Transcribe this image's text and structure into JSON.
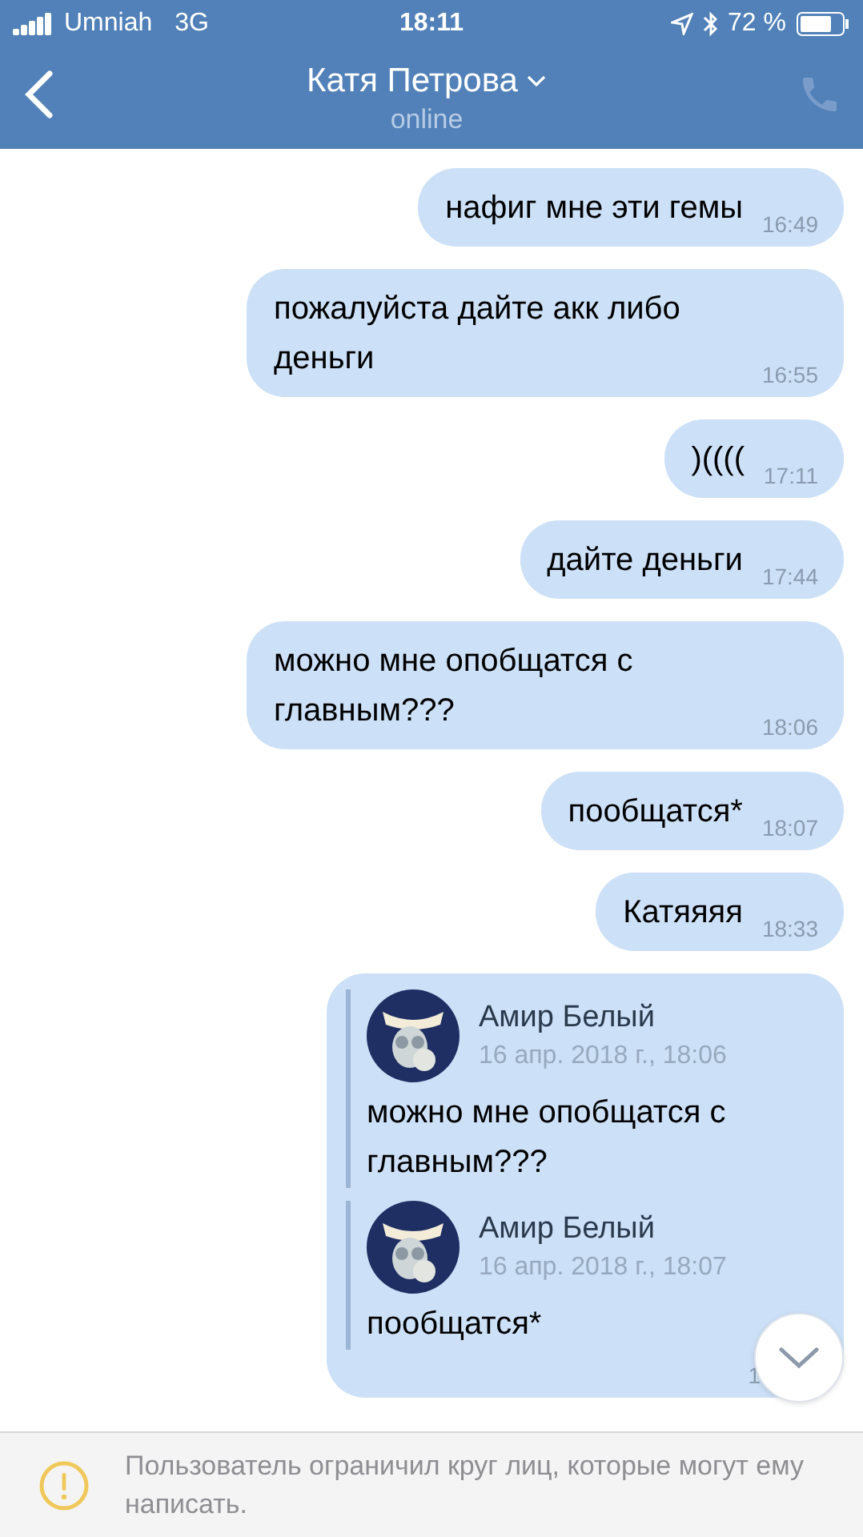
{
  "status_bar": {
    "carrier": "Umniah",
    "network": "3G",
    "time": "18:11",
    "battery": "72 %"
  },
  "header": {
    "title": "Катя Петрова",
    "status": "online"
  },
  "messages": [
    {
      "kind": "text",
      "text": "нафиг мне эти гемы",
      "time": "16:49"
    },
    {
      "kind": "text",
      "text": "пожалуйста дайте акк либо деньги",
      "time": "16:55"
    },
    {
      "kind": "text",
      "text": ")((((",
      "time": "17:11"
    },
    {
      "kind": "text",
      "text": "дайте деньги",
      "time": "17:44"
    },
    {
      "kind": "text",
      "text": "можно мне опобщатся с главным???",
      "time": "18:06"
    },
    {
      "kind": "text",
      "text": "пообщатся*",
      "time": "18:07"
    },
    {
      "kind": "text",
      "text": "Катяяяя",
      "time": "18:33"
    },
    {
      "kind": "forward",
      "time": "1",
      "forwards": [
        {
          "author": "Амир Белый",
          "date": "16 апр. 2018 г., 18:06",
          "text": "можно мне опобщатся с главным???"
        },
        {
          "author": "Амир Белый",
          "date": "16 апр. 2018 г., 18:07",
          "text": "пообщатся*"
        }
      ]
    }
  ],
  "notice": {
    "text": "Пользователь ограничил круг лиц, которые могут ему написать."
  }
}
